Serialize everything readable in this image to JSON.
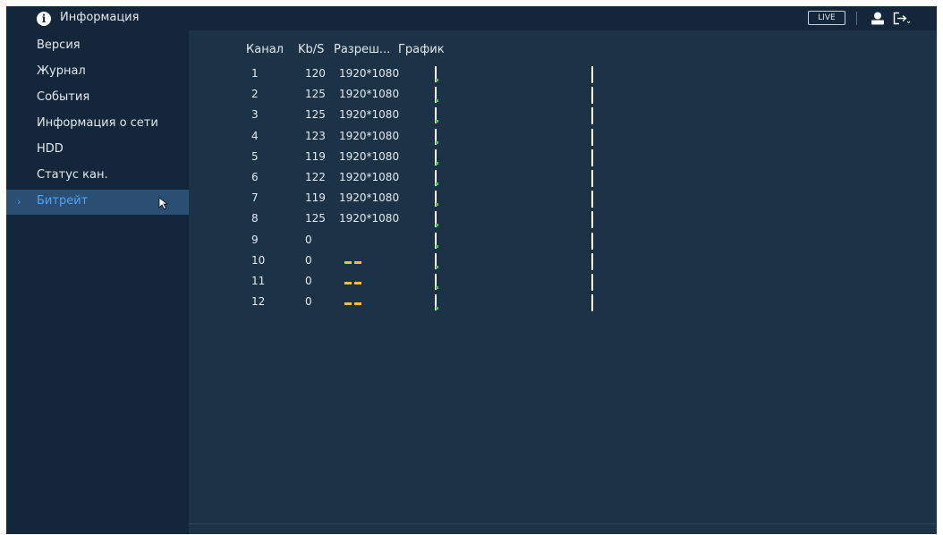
{
  "header": {
    "title": "Информация",
    "info_icon": "info-icon",
    "live_label": "LIVE",
    "user_icon": "user-icon",
    "logout_icon": "logout-icon"
  },
  "sidebar": {
    "items": [
      {
        "label": "Версия",
        "active": false
      },
      {
        "label": "Журнал",
        "active": false
      },
      {
        "label": "События",
        "active": false
      },
      {
        "label": "Информация о сети",
        "active": false
      },
      {
        "label": "HDD",
        "active": false
      },
      {
        "label": "Статус кан.",
        "active": false
      },
      {
        "label": "Битрейт",
        "active": true
      }
    ]
  },
  "table": {
    "columns": [
      "Канал",
      "Kb/S",
      "Разреш...",
      "График"
    ],
    "rows": [
      {
        "channel": "1",
        "kbps": "120",
        "resolution": "1920*1080"
      },
      {
        "channel": "2",
        "kbps": "125",
        "resolution": "1920*1080"
      },
      {
        "channel": "3",
        "kbps": "125",
        "resolution": "1920*1080"
      },
      {
        "channel": "4",
        "kbps": "123",
        "resolution": "1920*1080"
      },
      {
        "channel": "5",
        "kbps": "119",
        "resolution": "1920*1080"
      },
      {
        "channel": "6",
        "kbps": "122",
        "resolution": "1920*1080"
      },
      {
        "channel": "7",
        "kbps": "119",
        "resolution": "1920*1080"
      },
      {
        "channel": "8",
        "kbps": "125",
        "resolution": "1920*1080"
      },
      {
        "channel": "9",
        "kbps": "0",
        "resolution": ""
      },
      {
        "channel": "10",
        "kbps": "0",
        "resolution": "--"
      },
      {
        "channel": "11",
        "kbps": "0",
        "resolution": "--"
      },
      {
        "channel": "12",
        "kbps": "0",
        "resolution": "--"
      }
    ]
  },
  "colors": {
    "background": "#1c3247",
    "sidebar": "#13263a",
    "active_item": "#2a4f73",
    "accent": "#4fa3f2",
    "dash": "#f2c230",
    "graph_marker": "#3fcf4f"
  }
}
